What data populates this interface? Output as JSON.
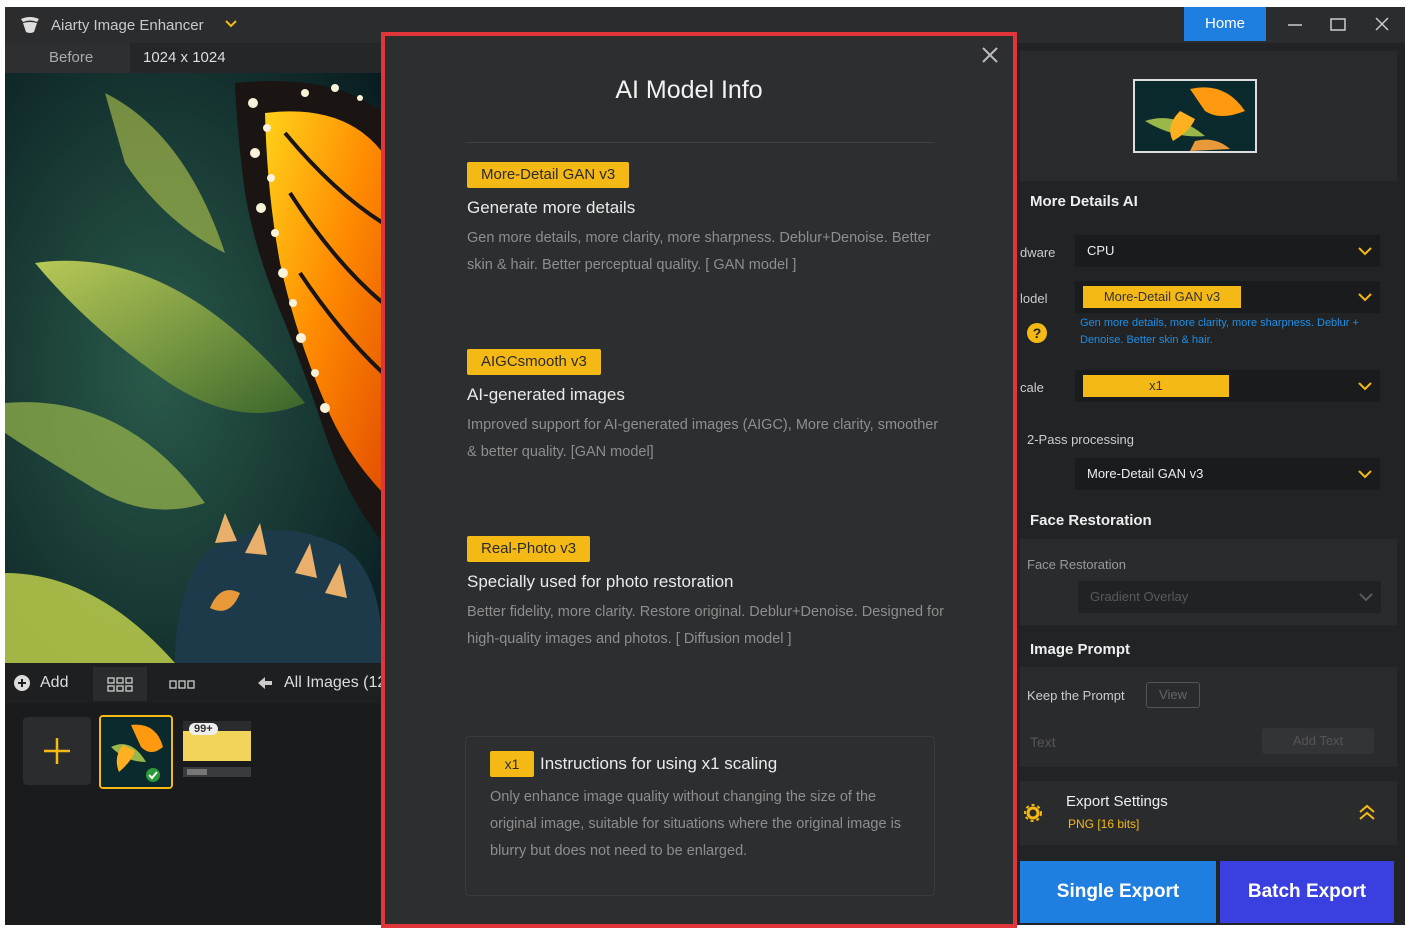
{
  "app": {
    "title": "Aiarty Image Enhancer",
    "home_label": "Home"
  },
  "left": {
    "before_label": "Before",
    "image_size": "1024 x 1024",
    "add_label": "Add",
    "all_images_label": "All Images (12",
    "thumb_badge": "99+"
  },
  "modal": {
    "title": "AI Model Info",
    "models": [
      {
        "tag": "More-Detail GAN v3",
        "heading": "Generate more details",
        "description": "Gen more details, more clarity, more sharpness. Deblur+Denoise. Better skin & hair. Better perceptual quality. [ GAN model ]"
      },
      {
        "tag": "AIGCsmooth v3",
        "heading": "AI-generated images",
        "description": "Improved support for AI-generated images (AIGC), More clarity, smoother & better quality. [GAN model]"
      },
      {
        "tag": "Real-Photo v3",
        "heading": "Specially used for photo restoration",
        "description": "Better fidelity, more clarity. Restore original. Deblur+Denoise. Designed for high-quality images and photos. [ Diffusion model ]"
      }
    ],
    "note": {
      "tag": "x1",
      "heading": "Instructions for using x1 scaling",
      "description": "Only enhance image quality without changing the size of the original image, suitable for situations where the original image is blurry but does not need to be enlarged."
    }
  },
  "right": {
    "section_ai": "More Details AI",
    "hardware_label": "dware",
    "hardware_value": "CPU",
    "model_label": "lodel",
    "model_value": "More-Detail GAN  v3",
    "model_desc": "Gen more details, more clarity, more sharpness. Deblur + Denoise. Better skin & hair.",
    "scale_label": "cale",
    "scale_value": "x1",
    "twopass_label": "2-Pass processing",
    "twopass_value": "More-Detail GAN  v3",
    "section_face": "Face Restoration",
    "face_label": "Face Restoration",
    "face_value": "Gradient Overlay",
    "section_prompt": "Image Prompt",
    "keep_prompt_label": "Keep the Prompt",
    "view_label": "View",
    "text_placeholder": "Text",
    "add_text_label": "Add Text",
    "export_title": "Export Settings",
    "export_format": "PNG   [16 bits]",
    "single_export": "Single Export",
    "batch_export": "Batch Export"
  },
  "colors": {
    "accent_yellow": "#f5b916",
    "accent_blue": "#1f7fe0",
    "accent_purple": "#3a3fe0",
    "modal_border": "#e0363a"
  }
}
